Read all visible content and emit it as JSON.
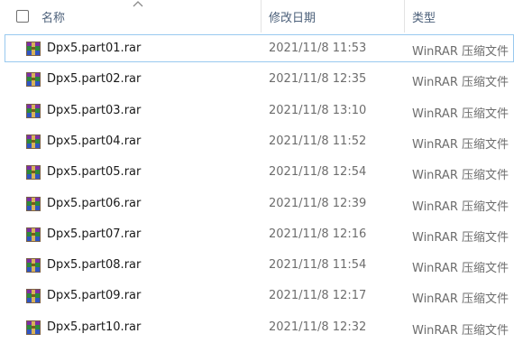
{
  "header": {
    "name_label": "名称",
    "date_label": "修改日期",
    "type_label": "类型"
  },
  "files": [
    {
      "name": "Dpx5.part01.rar",
      "date": "2021/11/8 11:53",
      "type": "WinRAR 压缩文件",
      "selected": true
    },
    {
      "name": "Dpx5.part02.rar",
      "date": "2021/11/8 12:35",
      "type": "WinRAR 压缩文件"
    },
    {
      "name": "Dpx5.part03.rar",
      "date": "2021/11/8 13:10",
      "type": "WinRAR 压缩文件"
    },
    {
      "name": "Dpx5.part04.rar",
      "date": "2021/11/8 11:52",
      "type": "WinRAR 压缩文件"
    },
    {
      "name": "Dpx5.part05.rar",
      "date": "2021/11/8 12:54",
      "type": "WinRAR 压缩文件"
    },
    {
      "name": "Dpx5.part06.rar",
      "date": "2021/11/8 12:39",
      "type": "WinRAR 压缩文件"
    },
    {
      "name": "Dpx5.part07.rar",
      "date": "2021/11/8 12:16",
      "type": "WinRAR 压缩文件"
    },
    {
      "name": "Dpx5.part08.rar",
      "date": "2021/11/8 11:54",
      "type": "WinRAR 压缩文件"
    },
    {
      "name": "Dpx5.part09.rar",
      "date": "2021/11/8 12:17",
      "type": "WinRAR 压缩文件"
    },
    {
      "name": "Dpx5.part10.rar",
      "date": "2021/11/8 12:32",
      "type": "WinRAR 压缩文件"
    }
  ],
  "icons": {
    "file_icon": "winrar-archive-icon",
    "sort": "sort-ascending-chevron-icon"
  },
  "colors": {
    "selection_border": "#99c9ef",
    "header_text": "#4c607a",
    "secondary_text": "#6d6d6d"
  }
}
